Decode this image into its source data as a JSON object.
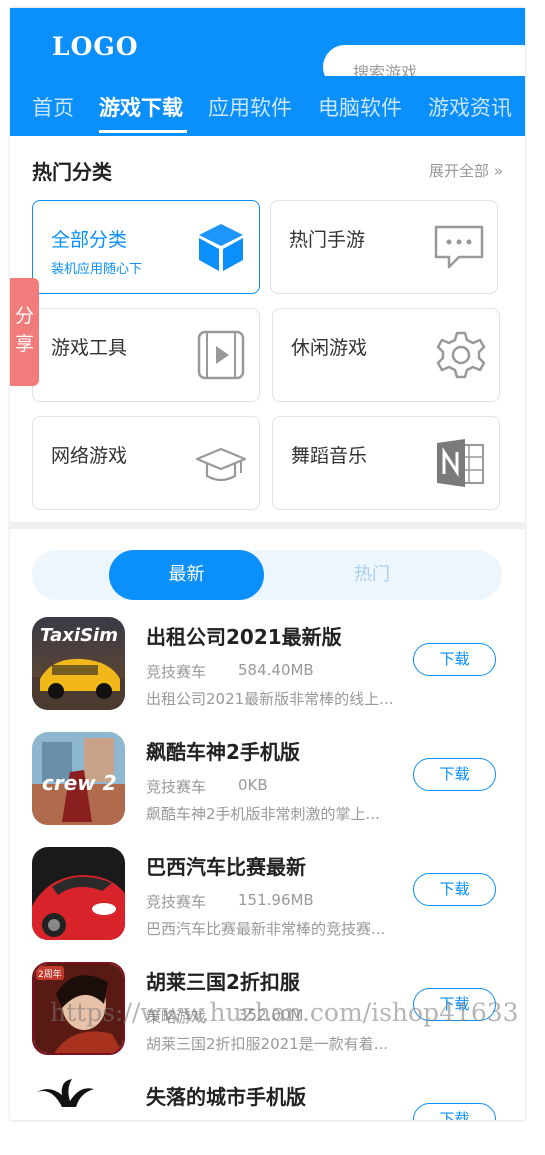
{
  "header": {
    "logo": "LOGO",
    "search_placeholder": "搜索游戏",
    "nav": [
      "首页",
      "游戏下载",
      "应用软件",
      "电脑软件",
      "游戏资讯"
    ],
    "active_nav": "游戏下载"
  },
  "categories": {
    "title": "热门分类",
    "expand": "展开全部 »",
    "items": [
      {
        "name": "全部分类",
        "sub": "装机应用随心下",
        "icon": "cube-icon"
      },
      {
        "name": "热门手游",
        "icon": "chat-bubble-icon"
      },
      {
        "name": "游戏工具",
        "icon": "video-play-icon"
      },
      {
        "name": "休闲游戏",
        "icon": "gear-icon"
      },
      {
        "name": "网络游戏",
        "icon": "graduation-cap-icon"
      },
      {
        "name": "舞蹈音乐",
        "icon": "onenote-icon"
      }
    ]
  },
  "share": "分享",
  "tabs": {
    "newest": "最新",
    "hot": "热门"
  },
  "apps": [
    {
      "name": "出租公司2021最新版",
      "category": "竞技赛车",
      "size": "584.40MB",
      "desc": "出租公司2021最新版非常棒的线上...",
      "button": "下载"
    },
    {
      "name": "飙酷车神2手机版",
      "category": "竞技赛车",
      "size": "0KB",
      "desc": "飙酷车神2手机版非常刺激的掌上...",
      "button": "下载"
    },
    {
      "name": "巴西汽车比赛最新",
      "category": "竞技赛车",
      "size": "151.96MB",
      "desc": "巴西汽车比赛最新非常棒的竞技赛...",
      "button": "下载"
    },
    {
      "name": "胡莱三国2折扣服",
      "category": "策略游戏",
      "size": "352.00M",
      "desc": "胡莱三国2折扣服2021是一款有着...",
      "button": "下载"
    },
    {
      "name": "失落的城市手机版",
      "category": "",
      "size": "",
      "desc": "",
      "button": "下载"
    }
  ],
  "watermark": "https://www.huzhan.com/ishop41633",
  "colors": {
    "primary": "#0a8ffb",
    "share": "#f27b7b"
  }
}
